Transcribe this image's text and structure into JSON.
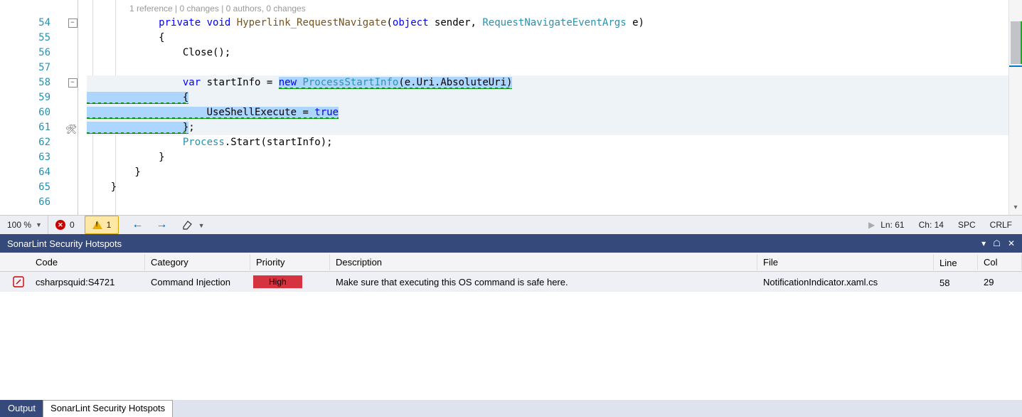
{
  "codelens": "1 reference | 0 changes | 0 authors, 0 changes",
  "lines": {
    "54": {
      "parts": [
        {
          "t": "            ",
          "c": ""
        },
        {
          "t": "private",
          "c": "kw"
        },
        {
          "t": " "
        },
        {
          "t": "void",
          "c": "kw"
        },
        {
          "t": " "
        },
        {
          "t": "Hyperlink_RequestNavigate",
          "c": "brown"
        },
        {
          "t": "("
        },
        {
          "t": "object",
          "c": "kw"
        },
        {
          "t": " sender, "
        },
        {
          "t": "RequestNavigateEventArgs",
          "c": "type"
        },
        {
          "t": " e)"
        }
      ]
    },
    "55": {
      "parts": [
        {
          "t": "            {"
        }
      ]
    },
    "56": {
      "parts": [
        {
          "t": "                Close();"
        }
      ]
    },
    "57": {
      "parts": [
        {
          "t": ""
        }
      ]
    },
    "58": {
      "hl": true,
      "parts": [
        {
          "t": "                "
        },
        {
          "t": "var",
          "c": "kw"
        },
        {
          "t": " startInfo = "
        },
        {
          "t": "new ",
          "c": "kw",
          "sel": true
        },
        {
          "t": "ProcessStartInfo",
          "c": "type",
          "sel": true
        },
        {
          "t": "(e.Uri.AbsoluteUri)",
          "sel": true
        }
      ]
    },
    "59": {
      "hl": true,
      "selPrefix": "                ",
      "parts": [
        {
          "t": "                ",
          "sel": true
        },
        {
          "t": "{",
          "sel": true
        }
      ]
    },
    "60": {
      "hl": true,
      "selPrefix": "                ",
      "parts": [
        {
          "t": "                    ",
          "sel": true
        },
        {
          "t": "UseShellExecute = ",
          "sel": true
        },
        {
          "t": "true",
          "c": "kw",
          "sel": true
        }
      ]
    },
    "61": {
      "hl": true,
      "selPrefix": "                ",
      "parts": [
        {
          "t": "                ",
          "sel": true
        },
        {
          "t": "}",
          "sel": true
        },
        {
          "t": ";"
        }
      ]
    },
    "62": {
      "parts": [
        {
          "t": "                "
        },
        {
          "t": "Process",
          "c": "type"
        },
        {
          "t": ".Start(startInfo);"
        }
      ]
    },
    "63": {
      "parts": [
        {
          "t": "            }"
        }
      ]
    },
    "64": {
      "parts": [
        {
          "t": "        }"
        }
      ]
    },
    "65": {
      "parts": [
        {
          "t": "    }"
        }
      ]
    },
    "66": {
      "parts": [
        {
          "t": ""
        }
      ]
    }
  },
  "lineNumbers": [
    "54",
    "55",
    "56",
    "57",
    "58",
    "59",
    "60",
    "61",
    "62",
    "63",
    "64",
    "65",
    "66"
  ],
  "status": {
    "zoom": "100 %",
    "errors": "0",
    "warnings": "1",
    "ln": "Ln: 61",
    "ch": "Ch: 14",
    "spc": "SPC",
    "crlf": "CRLF"
  },
  "panel": {
    "title": "SonarLint Security Hotspots"
  },
  "columns": {
    "code": "Code",
    "category": "Category",
    "priority": "Priority",
    "description": "Description",
    "file": "File",
    "line": "Line",
    "col": "Col"
  },
  "row": {
    "code": "csharpsquid:S4721",
    "category": "Command Injection",
    "priority": "High",
    "description": "Make sure that executing this OS command is safe here.",
    "file": "NotificationIndicator.xaml.cs",
    "line": "58",
    "col": "29"
  },
  "tabs": {
    "output": "Output",
    "hotspots": "SonarLint Security Hotspots"
  },
  "chart_data": null
}
